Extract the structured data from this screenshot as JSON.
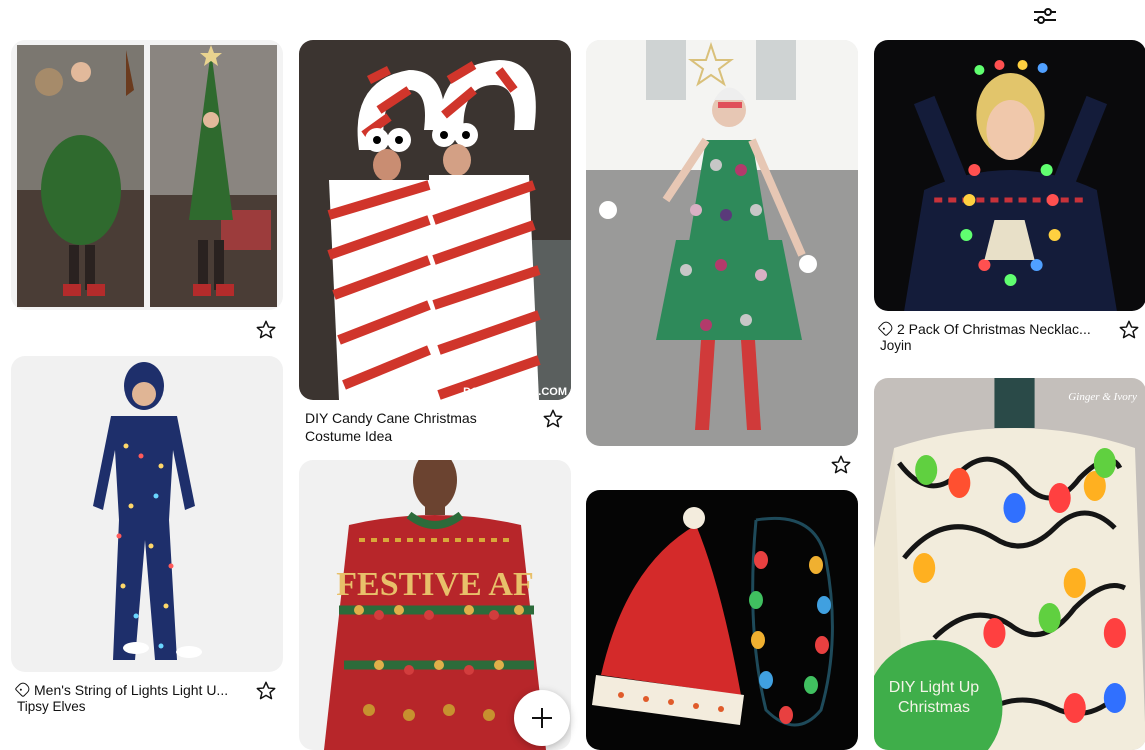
{
  "toolbar": {
    "filter_icon": "sliders-icon",
    "add_icon": "plus-icon"
  },
  "pins": [
    {
      "id": "tree-sweater",
      "caption": "",
      "source": "",
      "tagged": false
    },
    {
      "id": "candy-cane",
      "caption": "DIY Candy Cane Christmas Costume Idea",
      "source": "",
      "tagged": false,
      "watermark": "DOOBYBRAIN.COM"
    },
    {
      "id": "tree-dress",
      "caption": "",
      "source": "",
      "tagged": false
    },
    {
      "id": "necklace",
      "caption": "2 Pack Of Christmas Necklac...",
      "source": "Joyin",
      "tagged": true
    },
    {
      "id": "onesie",
      "caption": "Men's String of Lights Light U...",
      "source": "Tipsy Elves",
      "tagged": true
    },
    {
      "id": "festive-sweater",
      "caption": "",
      "source": "",
      "tagged": false,
      "sweater_text": "FESTIVE AF"
    },
    {
      "id": "santa-hat",
      "caption": "",
      "source": "",
      "tagged": false
    },
    {
      "id": "light-sweater",
      "caption": "",
      "source": "",
      "tagged": false,
      "overlay_text": "DIY Light Up Christmas",
      "watermark": "Ginger & Ivory"
    }
  ],
  "colors": {
    "accent": "#e60023",
    "text": "#111111"
  }
}
